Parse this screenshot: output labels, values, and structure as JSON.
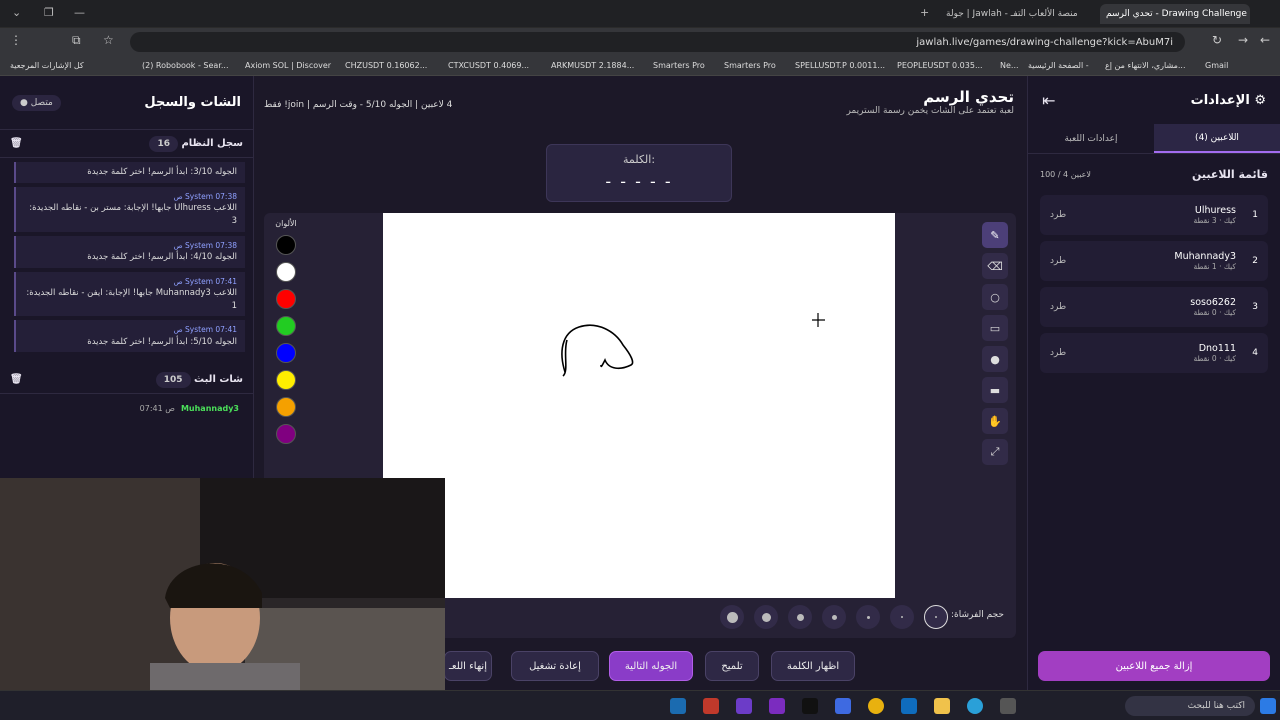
{
  "tabs": [
    {
      "label": "تحدي الرسم - Drawing Challenge"
    },
    {
      "label": "جولة | Jawlah - منصة الألعاب التفـ"
    }
  ],
  "browser": {
    "url": "jawlah.live/games/drawing-challenge?kick=AbuM7i"
  },
  "bookmarks": [
    "كل الإشارات المرجعية",
    "(2) Robobook - Sear...",
    "Axiom SOL | Discover",
    "CHZUSDT 0.16062...",
    "CTXCUSDT 0.4069...",
    "ARKMUSDT 2.1884...",
    "Smarters Pro",
    "Smarters Pro",
    "SPELLUSDT.P 0.0011...",
    "PEOPLEUSDT 0.035...",
    "Ne...",
    "الصفحة الرئيسية -",
    "مشاري، الانتهاء من إع...",
    "Gmail"
  ],
  "left": {
    "title": "الشات والسجل",
    "status": "متصل",
    "syslog_title": "سجل النظام",
    "syslog_count": "16",
    "messages": [
      {
        "meta": "",
        "text": "الجوله 3/10: ابدأ الرسم! اختر كلمة جديدة"
      },
      {
        "meta": "System 07:38 ص",
        "text": "اللاعب Ulhuress جابها! الإجابة: مستر بن - نقاطه الجديدة: 3"
      },
      {
        "meta": "System 07:38 ص",
        "text": "الجوله 4/10: ابدأ الرسم! اختر كلمة جديدة"
      },
      {
        "meta": "System 07:41 ص",
        "text": "اللاعب Muhannady3 جابها! الإجابة: ايفن - نقاطه الجديدة: 1"
      },
      {
        "meta": "System 07:41 ص",
        "text": "الجوله 5/10: ابدأ الرسم! اختر كلمة جديدة"
      }
    ],
    "stream_title": "شات البث",
    "stream_count": "105",
    "last_user": "Muhannady3",
    "last_time": "07:41 ص"
  },
  "center": {
    "title": "تحدي الرسم",
    "subtitle": "لعبة تعتمد على الشات يخمن رسمة الستريمر",
    "round": "4 لاعبين | الجوله 5/10 - وقت الرسم | join! فقط",
    "word_label": "الكلمة:",
    "word_blanks": "- - - - -",
    "colors_label": "الألوان",
    "brush_label": "حجم الفرشاة:",
    "buttons": {
      "show_word": "اظهار الكلمة",
      "hint": "تلميح",
      "next": "الجوله التالية",
      "restart": "إعادة تشغيل",
      "end": "إنهاء اللعـ"
    }
  },
  "colors": [
    "#000000",
    "#ffffff",
    "#ff0000",
    "#22cc22",
    "#0000ff",
    "#ffee00",
    "#f5a000",
    "#800080"
  ],
  "right": {
    "title": "الإعدادات",
    "tab_players": "اللاعبين (4)",
    "tab_game": "إعدادات اللعبة",
    "list_title": "قائمة اللاعبين",
    "list_count": "100 / 4 لاعبين",
    "kick_label": "طرد",
    "players": [
      {
        "rank": "1",
        "name": "Ulhuress",
        "pts": "كيك · 3 نقطة"
      },
      {
        "rank": "2",
        "name": "Muhannady3",
        "pts": "كيك · 1 نقطة"
      },
      {
        "rank": "3",
        "name": "soso6262",
        "pts": "كيك · 0 نقطة"
      },
      {
        "rank": "4",
        "name": "Dno111",
        "pts": "كيك · 0 نقطة"
      }
    ],
    "remove_all": "إزالة جميع اللاعبين"
  },
  "taskbar": {
    "search": "اكتب هنا للبحث"
  }
}
